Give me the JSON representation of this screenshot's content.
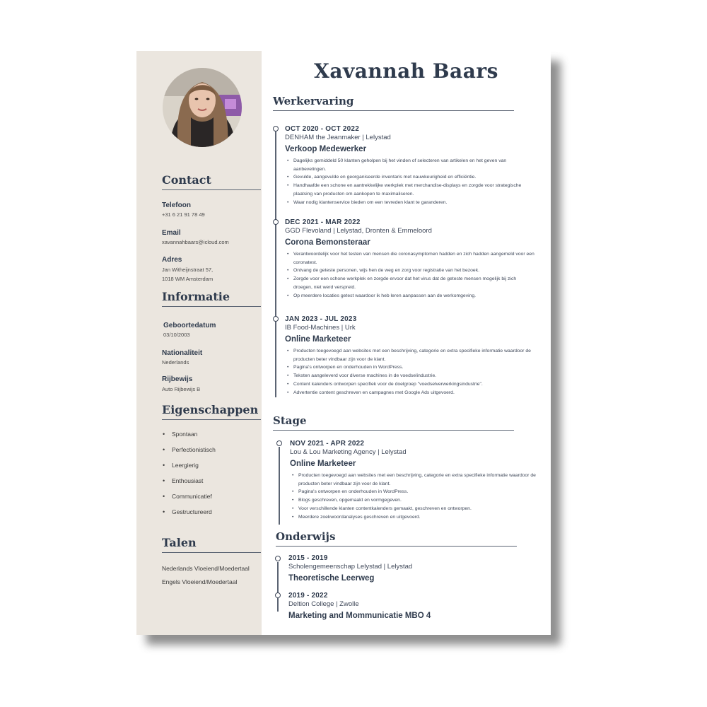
{
  "name": "Xavannah Baars",
  "sidebar": {
    "contact": {
      "heading": "Contact",
      "phone_label": "Telefoon",
      "phone": "+31 6 21 91 78 49",
      "email_label": "Email",
      "email": "xavannahbaars@icloud.com",
      "address_label": "Adres",
      "address": "Jan Witheijnstraat 57,\n1018 WM Amsterdam"
    },
    "info": {
      "heading": "Informatie",
      "birth_label": "Geboortedatum",
      "birth": "03/10/2003",
      "nat_label": "Nationaliteit",
      "nat": "Nederlands",
      "license_label": "Rijbewijs",
      "license": "Auto Rijbewijs B"
    },
    "traits": {
      "heading": "Eigenschappen",
      "items": [
        "Spontaan",
        "Perfectionistisch",
        "Leergierig",
        "Enthousiast",
        "Communicatief",
        "Gestructureerd"
      ]
    },
    "languages": {
      "heading": "Talen",
      "items": [
        "Nederlands Vloeiend/Moedertaal",
        "Engels Vloeiend/Moedertaal"
      ]
    }
  },
  "work": {
    "heading": "Werkervaring",
    "jobs": [
      {
        "date": "OCT 2020 - OCT 2022",
        "org": "DENHAM the Jeanmaker | Lelystad",
        "role": "Verkoop Medewerker",
        "bullets": [
          "Dagelijks gemiddeld 50 klanten geholpen bij het vinden of selecteren van artikelen en het geven van aanbevelingen.",
          "Gevulde, aangevulde en georganiseerde inventaris met nauwkeurigheid en efficiëntie.",
          "Handhaafde een schone en aantrekkelijke werkplek met merchandise-displays en zorgde voor strategische plaatsing van producten om aankopen te maximaliseren.",
          "Waar nodig klantenservice bieden om een tevreden klant te garanderen."
        ]
      },
      {
        "date": "DEC 2021 -  MAR 2022",
        "org": "GGD Flevoland | Lelystad, Dronten & Emmeloord",
        "role": "Corona Bemonsteraar",
        "bullets": [
          "Verantwoordelijk voor het testen van mensen die coronasymptomen hadden en zich hadden aangemeld voor een coronatest.",
          "Ontvang de geteste personen, wijs hen de weg en zorg voor registratie van het bezoek.",
          "Zorgde voor een schone werkplek en zorgde ervoor dat het virus dat de geteste mensen mogelijk bij zich droegen, niet werd verspreid.",
          "Op meerdere locaties getest waardoor ik heb leren aanpassen aan de werkomgeving."
        ]
      },
      {
        "date": "JAN 2023 -  JUL 2023",
        "org": "IB Food-Machines | Urk",
        "role": "Online Marketeer",
        "bullets": [
          "Producten toegevoegd aan websites met een beschrijving, categorie en extra specifieke informatie waardoor de producten beter vindbaar zijn voor de klant.",
          "Pagina's ontworpen en onderhouden in WordPress.",
          "Teksten aangeleverd voor diverse machines in de voedselindustrie.",
          "Content kalenders ontworpen specifiek voor de doelgroep \"voedselverwerkingsindustrie\".",
          "Advertentie content geschreven en campagnes met Google Ads uitgevoerd."
        ]
      }
    ]
  },
  "stage": {
    "heading": "Stage",
    "jobs": [
      {
        "date": "NOV 2021 - APR 2022",
        "org": "Lou & Lou Marketing Agency | Lelystad",
        "role": "Online Marketeer",
        "bullets": [
          "Producten toegevoegd aan websites met een beschrijving, categorie en extra specifieke informatie waardoor de producten beter vindbaar zijn voor de klant.",
          "Pagina's ontworpen en onderhouden in WordPress.",
          "Blogs geschreven, opgemaakt en vormgegeven.",
          "Voor verschillende klanten contentkalenders gemaakt, geschreven en ontworpen.",
          "Meerdere zoekwoordanalyses geschreven en uitgevoerd."
        ]
      }
    ]
  },
  "education": {
    "heading": "Onderwijs",
    "items": [
      {
        "date": "2015 - 2019",
        "org": "Scholengemeenschap Lelystad | Lelystad",
        "title": "Theoretische Leerweg"
      },
      {
        "date": "2019 - 2022",
        "org": "Deltion College | Zwolle",
        "title": "Marketing and Mommunicatie MBO 4"
      }
    ]
  }
}
